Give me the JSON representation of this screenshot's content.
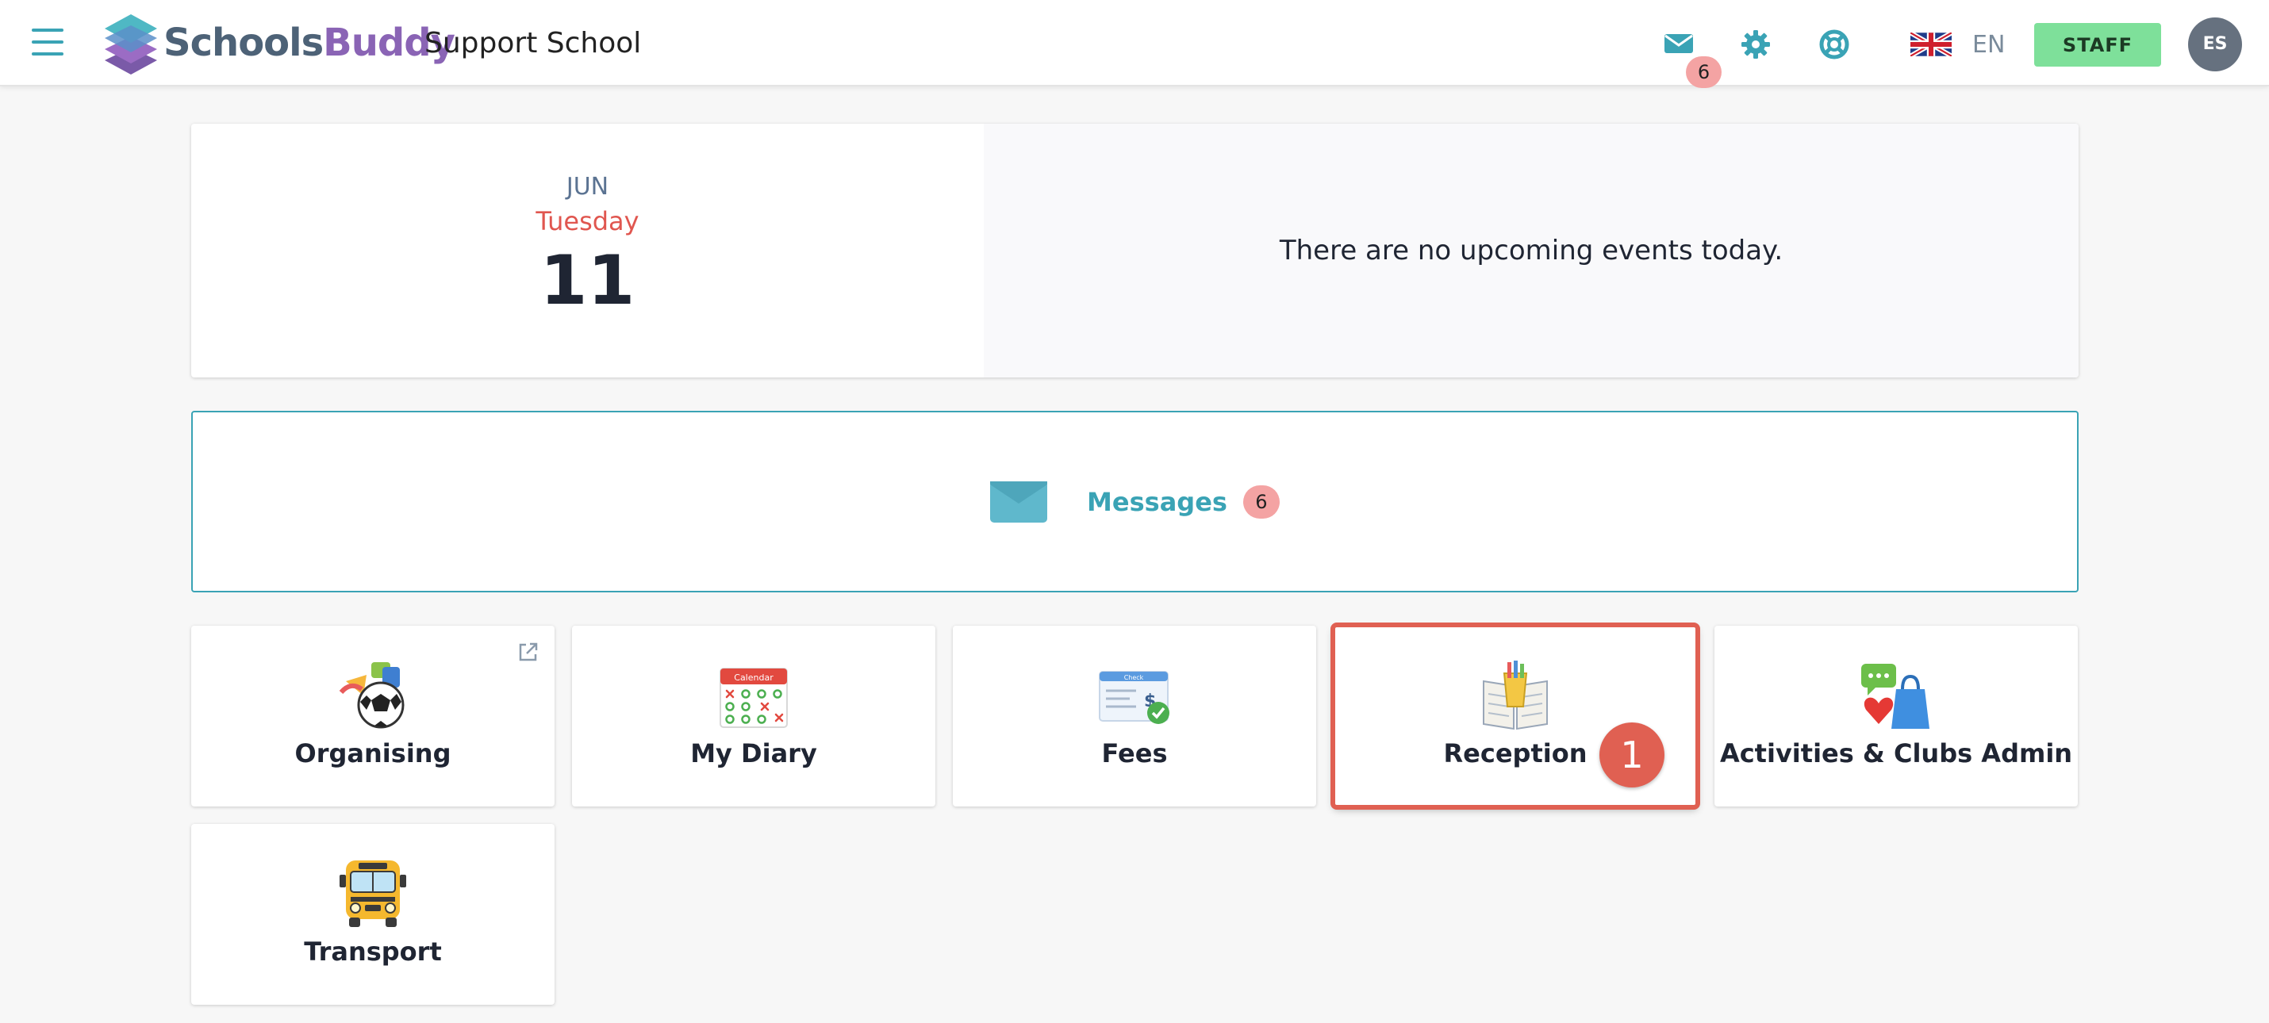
{
  "header": {
    "logo": {
      "part1": "Schools",
      "part2": "Buddy"
    },
    "school_name": "Support School",
    "mail_count": "6",
    "language": "EN",
    "staff_label": "STAFF",
    "avatar_initials": "ES"
  },
  "date_card": {
    "month": "JUN",
    "weekday": "Tuesday",
    "day": "11",
    "events_text": "There are no upcoming events today."
  },
  "messages": {
    "label": "Messages",
    "count": "6"
  },
  "tiles": [
    {
      "label": "Organising",
      "icon": "organising-icon",
      "external": true
    },
    {
      "label": "My Diary",
      "icon": "calendar-icon"
    },
    {
      "label": "Fees",
      "icon": "fees-check-icon"
    },
    {
      "label": "Reception",
      "icon": "reception-book-icon",
      "highlighted": true
    },
    {
      "label": "Activities & Clubs Admin",
      "icon": "activities-icon"
    },
    {
      "label": "Transport",
      "icon": "school-bus-icon"
    }
  ],
  "annotation": {
    "step": "1"
  },
  "colors": {
    "accent": "#3aa3b5",
    "badge": "#f4a3a3",
    "staff": "#7ee09a",
    "weekday": "#e0564f",
    "highlight": "#e06052"
  }
}
